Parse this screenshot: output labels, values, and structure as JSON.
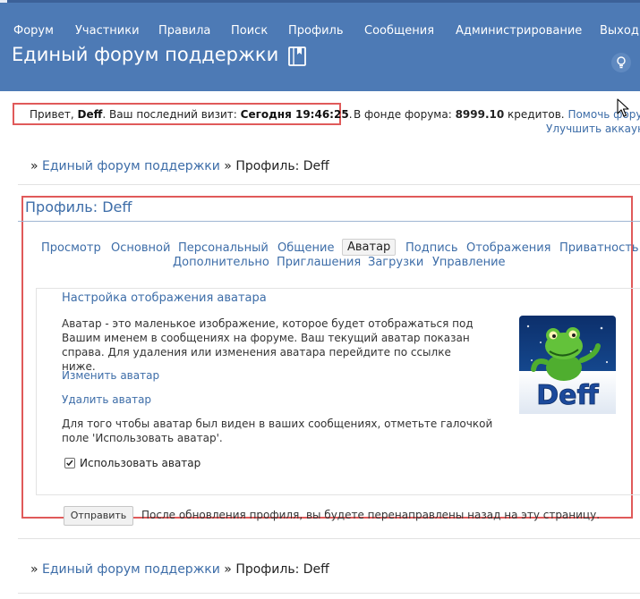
{
  "nav": {
    "items": [
      "Форум",
      "Участники",
      "Правила",
      "Поиск",
      "Профиль",
      "Сообщения",
      "Администрирование",
      "Выход"
    ]
  },
  "site": {
    "title": "Единый форум поддержки"
  },
  "greeting": {
    "hello": "Привет, ",
    "user": "Deff",
    "last_visit_label": ".   Ваш последний визит: ",
    "last_visit_value": "Сегодня 19:46:25",
    "end": "."
  },
  "fund": {
    "label": "В фонде форума: ",
    "amount": "8999.10",
    "unit": " кредитов. ",
    "help_link": "Помочь форуму",
    "upgrade_link": "Улучшить аккаунт"
  },
  "breadcrumb": {
    "prefix": "» ",
    "home": "Единый форум поддержки",
    "separator": " » ",
    "current": "Профиль: Deff"
  },
  "profile": {
    "title": "Профиль: Deff",
    "tabs_row1": [
      "Просмотр",
      "Основной",
      "Персональный",
      "Общение",
      "Аватар",
      "Подпись",
      "Отображения",
      "Приватность"
    ],
    "tabs_row2": [
      "Дополнительно",
      "Приглашения",
      "Загрузки",
      "Управление"
    ],
    "active_tab": "Аватар"
  },
  "avatar_panel": {
    "legend": "Настройка отображения аватара",
    "description": "Аватар - это маленькое изображение, которое будет отображаться под Вашим именем в сообщениях на форуме. Ваш текущий аватар показан справа. Для удаления или изменения аватара перейдите по ссылке ниже.",
    "change_link": "Изменить аватар",
    "delete_link": "Удалить аватар",
    "note": "Для того чтобы аватар был виден в ваших сообщениях, отметьте галочкой поле 'Использовать аватар'.",
    "use_avatar_label": "Использовать аватар",
    "use_avatar_checked": true,
    "avatar_text": "Deff"
  },
  "form": {
    "submit_label": "Отправить",
    "submit_note": "После обновления профиля, вы будете перенаправлены назад на эту страницу."
  },
  "colors": {
    "header_bg": "#4d7ab5",
    "link": "#3d6da8",
    "highlight_border": "#e05a5a"
  },
  "icons": [
    "book-icon",
    "lightbulb-icon",
    "cursor-icon",
    "checkmark-icon"
  ]
}
